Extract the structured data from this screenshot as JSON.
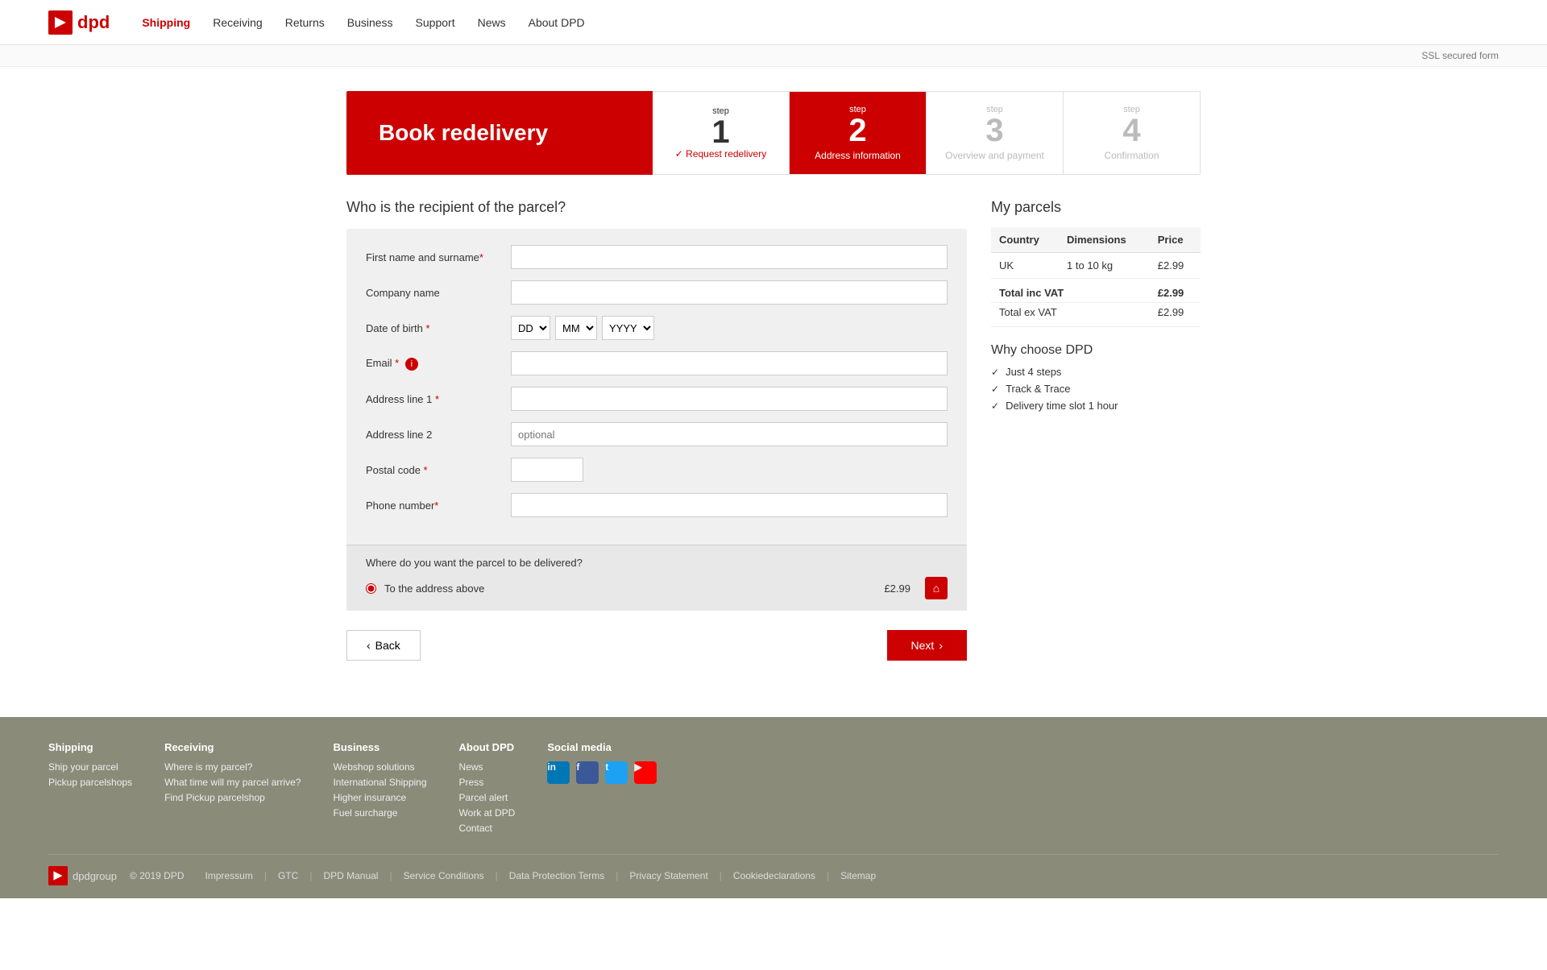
{
  "header": {
    "logo_text": "dpd",
    "nav": [
      {
        "label": "Shipping",
        "active": true
      },
      {
        "label": "Receiving",
        "active": false
      },
      {
        "label": "Returns",
        "active": false
      },
      {
        "label": "Business",
        "active": false
      },
      {
        "label": "Support",
        "active": false
      },
      {
        "label": "News",
        "active": false
      },
      {
        "label": "About DPD",
        "active": false
      }
    ],
    "ssl_text": "SSL secured form"
  },
  "steps": {
    "banner_title": "Book redelivery",
    "items": [
      {
        "step": "step",
        "number": "1",
        "name": "Request redelivery",
        "state": "done",
        "done_label": "✓ Request redelivery"
      },
      {
        "step": "step",
        "number": "2",
        "name": "Address information",
        "state": "active"
      },
      {
        "step": "step",
        "number": "3",
        "name": "Overview and payment",
        "state": "inactive"
      },
      {
        "step": "step",
        "number": "4",
        "name": "Confirmation",
        "state": "inactive"
      }
    ]
  },
  "form": {
    "section_title": "Who is the recipient of the parcel?",
    "fields": {
      "first_name_label": "First name and surname",
      "company_label": "Company name",
      "dob_label": "Date of birth",
      "dob_dd": "DD",
      "dob_mm": "MM",
      "dob_yyyy": "YYYY",
      "email_label": "Email",
      "address1_label": "Address line 1",
      "address2_label": "Address line 2",
      "address2_placeholder": "optional",
      "postal_label": "Postal code",
      "phone_label": "Phone number"
    },
    "delivery": {
      "title": "Where do you want the parcel to be delivered?",
      "option_label": "To the address above",
      "price": "£2.99"
    }
  },
  "parcels": {
    "title": "My parcels",
    "headers": [
      "Country",
      "Dimensions",
      "Price"
    ],
    "rows": [
      {
        "country": "UK",
        "dimensions": "1 to 10 kg",
        "price": "£2.99"
      }
    ],
    "total_inc_vat_label": "Total inc VAT",
    "total_inc_vat_value": "£2.99",
    "total_ex_vat_label": "Total ex VAT",
    "total_ex_vat_value": "£2.99"
  },
  "why": {
    "title": "Why choose DPD",
    "items": [
      "Just 4 steps",
      "Track & Trace",
      "Delivery time slot 1 hour"
    ]
  },
  "buttons": {
    "back": "Back",
    "next": "Next"
  },
  "footer": {
    "cols": [
      {
        "heading": "Shipping",
        "links": [
          "Ship your parcel",
          "Pickup parcelshops"
        ]
      },
      {
        "heading": "Receiving",
        "links": [
          "Where is my parcel?",
          "What time will my parcel arrive?",
          "Find Pickup parcelshop"
        ]
      },
      {
        "heading": "Business",
        "links": [
          "Webshop solutions",
          "International Shipping",
          "Higher insurance",
          "Fuel surcharge"
        ]
      },
      {
        "heading": "About DPD",
        "links": [
          "News",
          "Press",
          "Parcel alert",
          "Work at DPD",
          "Contact"
        ]
      }
    ],
    "social_heading": "Social media",
    "copyright": "© 2019 DPD",
    "bottom_links": [
      "Impressum",
      "GTC",
      "DPD Manual",
      "Service Conditions",
      "Data Protection Terms",
      "Privacy Statement",
      "Cookiedeclarations",
      "Sitemap"
    ]
  }
}
